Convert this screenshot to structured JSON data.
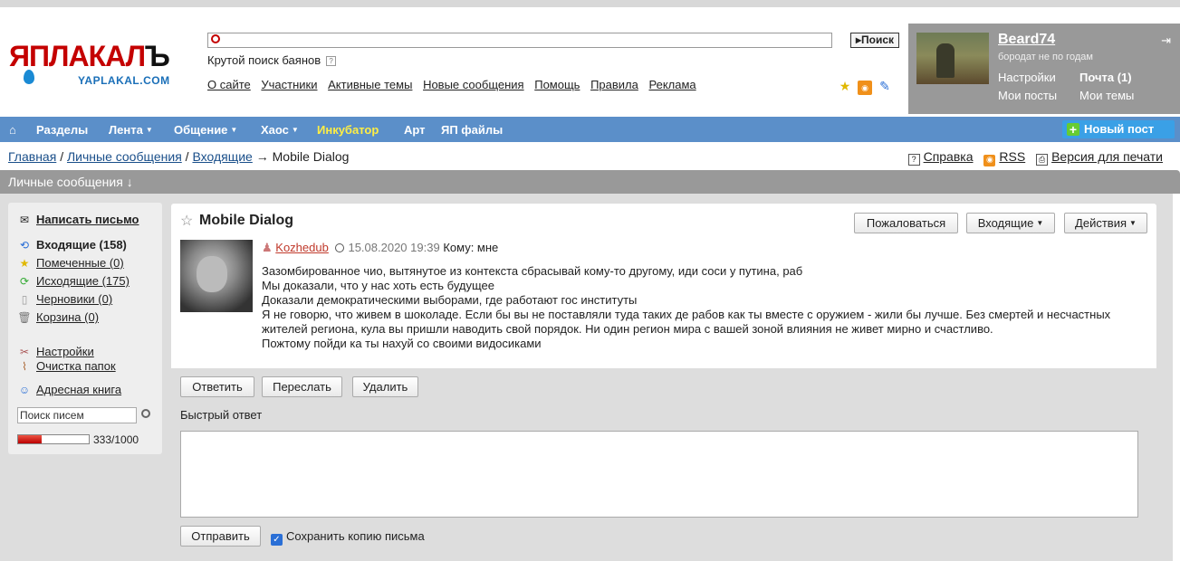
{
  "logo": {
    "main_red": "ЯПЛАКАЛ",
    "main_dark": "Ъ",
    "sub": "YAPLAKAL.COM"
  },
  "search": {
    "button": "Поиск",
    "hint": "Крутой поиск баянов"
  },
  "topnav": [
    "О сайте",
    "Участники",
    "Активные темы",
    "Новые сообщения",
    "Помощь",
    "Правила",
    "Реклама"
  ],
  "user": {
    "name": "Beard74",
    "tagline": "бородат не по годам",
    "settings": "Настройки",
    "mail": "Почта (1)",
    "my_posts": "Мои посты",
    "my_topics": "Мои темы"
  },
  "menu": {
    "sections": "Разделы",
    "feed": "Лента",
    "talk": "Общение",
    "chaos": "Хаос",
    "incubator": "Инкубатор",
    "art": "Арт",
    "files": "ЯП файлы",
    "new_post": "Новый пост"
  },
  "breadcrumbs": {
    "home": "Главная",
    "pm": "Личные сообщения",
    "inbox": "Входящие",
    "current": "→ Mobile Dialog",
    "sep": "/"
  },
  "right_links": {
    "help": "Справка",
    "rss": "RSS",
    "print": "Версия для печати"
  },
  "section_title": "Личные сообщения ↓",
  "left": {
    "write": "Написать письмо",
    "inbox": "Входящие (158)",
    "starred": "Помеченные (0)",
    "outbox": "Исходящие (175)",
    "drafts": "Черновики (0)",
    "trash": "Корзина (0)",
    "settings": "Настройки",
    "clean": "Очистка папок",
    "addressbook": "Адресная книга",
    "search_value": "Поиск писем",
    "quota_text": "333/1000",
    "quota_fraction": 0.333
  },
  "message": {
    "title": "Mobile Dialog",
    "report": "Пожаловаться",
    "inbox_btn": "Входящие",
    "actions_btn": "Действия",
    "author": "Kozhedub",
    "date": "15.08.2020 19:39",
    "to": "Кому: мне",
    "lines": [
      "Зазомбированное чио, вытянутое из контекста сбрасывай кому-то другому, иди соси у путина, раб",
      "Мы доказали, что у нас хоть есть будущее",
      "Доказали демократическими выборами, где работают гос институты",
      "Я не говорю, что живем в шоколаде. Если бы вы не поставляли туда таких де рабов как ты вместе с оружием - жили бы лучше. Без смертей и несчастных жителей региона, кула вы пришли наводить свой порядок. Ни один регион мира с вашей зоной влияния не живет мирно и счастливо.",
      "Пожтому пойди ка ты нахуй со своими видосиками"
    ]
  },
  "actions": {
    "reply": "Ответить",
    "forward": "Переслать",
    "delete": "Удалить"
  },
  "quick_reply": {
    "label": "Быстрый ответ",
    "send": "Отправить",
    "save_copy": "Сохранить копию письма"
  }
}
